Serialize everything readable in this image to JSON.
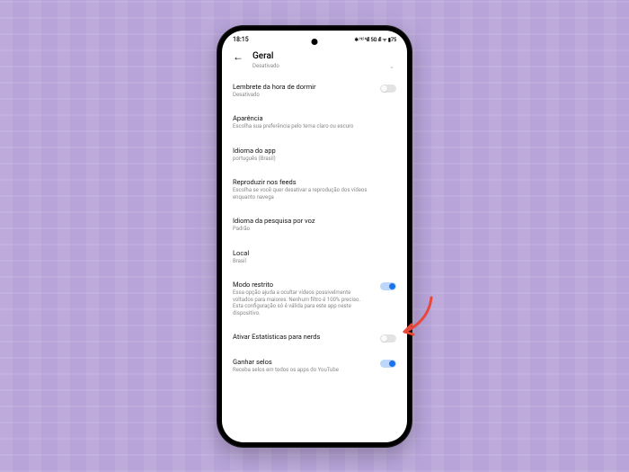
{
  "status_bar": {
    "time": "18:15",
    "right": "✱ ᴴᵈ ⁴ıll 5G ıll ᯤ ▮75"
  },
  "header": {
    "title": "Geral",
    "sub_status": "Desativado"
  },
  "items": {
    "sleep": {
      "title": "Lembrete da hora de dormir",
      "sub": "Desativado"
    },
    "appearance": {
      "title": "Aparência",
      "sub": "Escolha sua preferência pelo tema claro ou escuro"
    },
    "lang": {
      "title": "Idioma do app",
      "sub": "português (Brasil)"
    },
    "feeds": {
      "title": "Reproduzir nos feeds",
      "sub": "Escolha se você quer desativar a reprodução dos vídeos enquanto navega"
    },
    "voice": {
      "title": "Idioma da pesquisa por voz",
      "sub": "Padrão"
    },
    "local": {
      "title": "Local",
      "sub": "Brasil"
    },
    "restrict": {
      "title": "Modo restrito",
      "sub": "Essa opção ajuda a ocultar vídeos possivelmente voltados para maiores. Nenhum filtro é 100% preciso. Esta configuração só é válida para este app neste dispositivo."
    },
    "nerd": {
      "title": "Ativar Estatísticas para nerds"
    },
    "selos": {
      "title": "Ganhar selos",
      "sub": "Receba selos em todos os apps do YouTube"
    }
  },
  "colors": {
    "accent": "#1a73e8",
    "annotation": "#e8483b"
  }
}
